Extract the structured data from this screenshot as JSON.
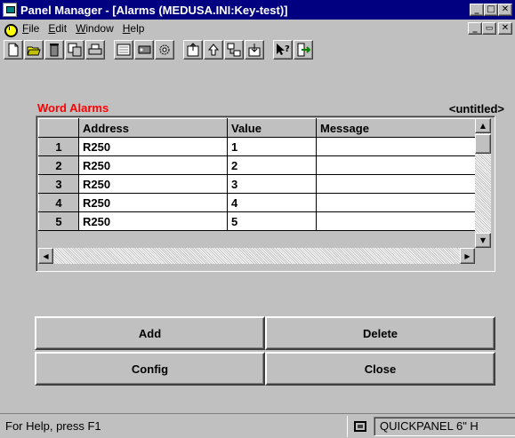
{
  "window": {
    "title": "Panel Manager - [Alarms (MEDUSA.INI:Key-test)]",
    "app_icon": "panel-app-icon",
    "controls": [
      "minimize-icon",
      "maximize-icon",
      "close-icon"
    ],
    "minimize_glyph": "_",
    "maximize_glyph": "□",
    "close_glyph": "✕",
    "restore_glyph": "🗗"
  },
  "menu": {
    "items": [
      {
        "label": "File",
        "accel": "F"
      },
      {
        "label": "Edit",
        "accel": "E"
      },
      {
        "label": "Window",
        "accel": "W"
      },
      {
        "label": "Help",
        "accel": "H"
      }
    ]
  },
  "toolbar": {
    "buttons": [
      "new-icon",
      "open-icon",
      "delete-icon",
      "copy-icon",
      "print-icon",
      "keypad-icon",
      "tag-icon",
      "settings-icon",
      "upload-icon",
      "transfer-up-icon",
      "network-icon",
      "download-icon",
      "context-help-icon",
      "exit-icon"
    ]
  },
  "panel": {
    "heading": "Word Alarms",
    "document": "<untitled>",
    "heading_color": "#ff0000"
  },
  "grid": {
    "columns": [
      "",
      "Address",
      "Value",
      "Message"
    ],
    "rows": [
      {
        "num": "1",
        "address": "R250",
        "value": "1",
        "message": ""
      },
      {
        "num": "2",
        "address": "R250",
        "value": "2",
        "message": ""
      },
      {
        "num": "3",
        "address": "R250",
        "value": "3",
        "message": ""
      },
      {
        "num": "4",
        "address": "R250",
        "value": "4",
        "message": ""
      },
      {
        "num": "5",
        "address": "R250",
        "value": "5",
        "message": ""
      }
    ]
  },
  "buttons": {
    "add": "Add",
    "delete": "Delete",
    "config": "Config",
    "close": "Close"
  },
  "status": {
    "text": "For Help, press F1",
    "device": "QUICKPANEL 6\" H"
  }
}
